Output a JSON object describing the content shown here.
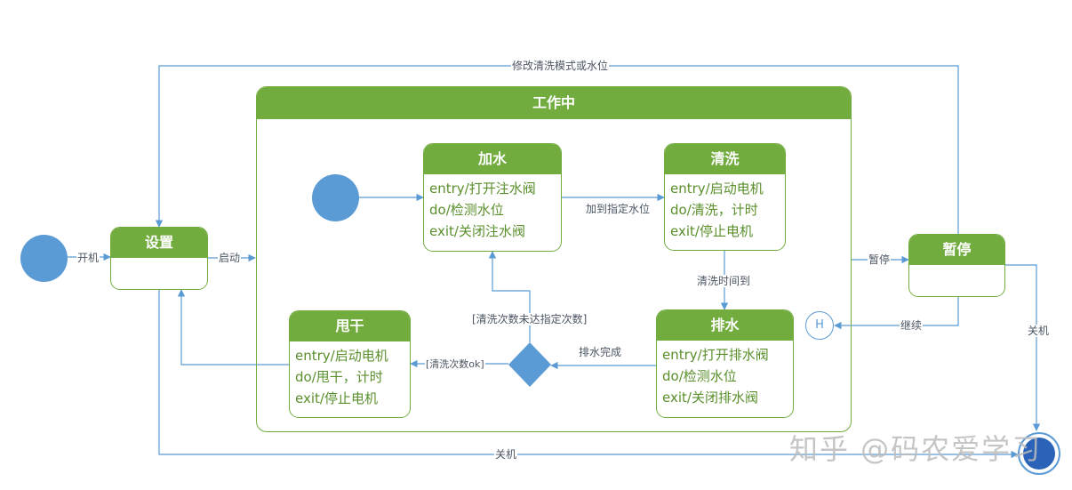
{
  "composite": {
    "title": "工作中"
  },
  "states": {
    "settings": {
      "title": "设置"
    },
    "add_water": {
      "title": "加水",
      "lines": [
        "entry/打开注水阀",
        "do/检测水位",
        "exit/关闭注水阀"
      ]
    },
    "wash": {
      "title": "清洗",
      "lines": [
        "entry/启动电机",
        "do/清洗，计时",
        "exit/停止电机"
      ]
    },
    "drain": {
      "title": "排水",
      "lines": [
        "entry/打开排水阀",
        "do/检测水位",
        "exit/关闭排水阀"
      ]
    },
    "spin": {
      "title": "甩干",
      "lines": [
        "entry/启动电机",
        "do/甩干，计时",
        "exit/停止电机"
      ]
    },
    "pause": {
      "title": "暂停"
    }
  },
  "history": {
    "label": "H"
  },
  "transitions": {
    "power_on": "开机",
    "start": "启动",
    "modify": "修改清洗模式或水位",
    "reach_level": "加到指定水位",
    "wash_time_up": "清洗时间到",
    "drain_done": "排水完成",
    "not_enough": "[清洗次数未达指定次数]",
    "count_ok": "[清洗次数ok]",
    "pause": "暂停",
    "resume": "继续",
    "power_off_right": "关机",
    "power_off_bottom": "关机"
  },
  "watermark": "知乎 @码农爱学习",
  "colors": {
    "state_green": "#72ac3f",
    "text_green": "#5a8f2c",
    "arrow_blue": "#5b9bd5",
    "final_blue": "#2a63b8"
  }
}
